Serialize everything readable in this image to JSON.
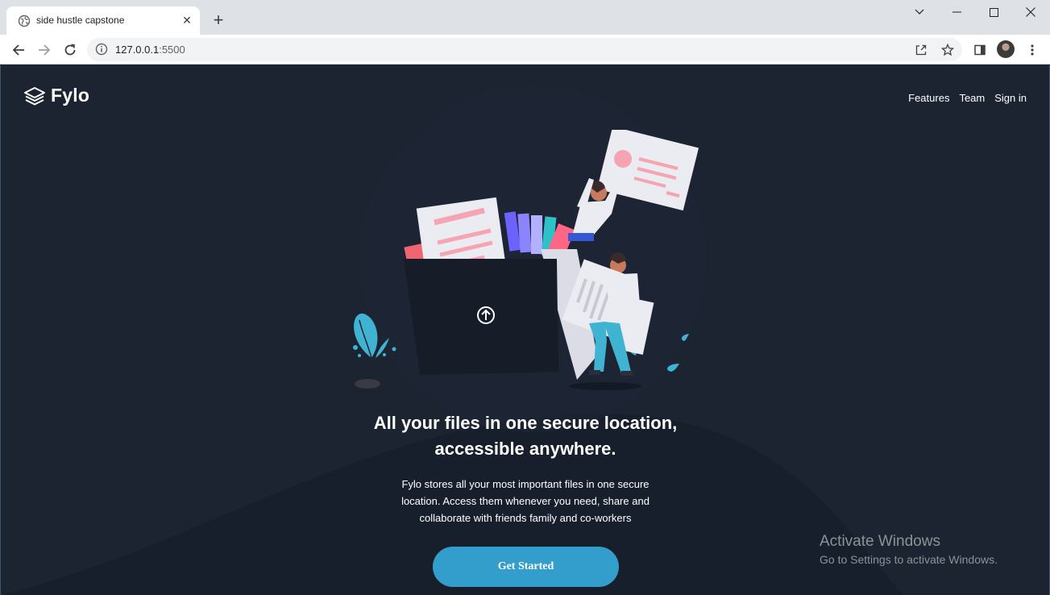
{
  "browser": {
    "tab_title": "side hustle capstone",
    "url_host": "127.0.0.1",
    "url_port": ":5500",
    "icons": {
      "favicon": "globe-icon",
      "tab_close": "close-icon",
      "new_tab": "plus-icon",
      "back": "back-arrow-icon",
      "forward": "forward-arrow-icon",
      "reload": "reload-icon",
      "site_info": "info-icon",
      "share": "share-icon",
      "bookmark": "star-icon",
      "side_panel": "side-panel-icon",
      "profile": "avatar",
      "menu": "kebab-menu-icon"
    },
    "window_controls": [
      "chevron-down-icon",
      "minimize-icon",
      "maximize-icon",
      "close-icon"
    ]
  },
  "page": {
    "brand": "Fylo",
    "nav": [
      "Features",
      "Team",
      "Sign in"
    ],
    "headline_line1": "All your files in one secure location,",
    "headline_line2": "accessible anywhere.",
    "subtext_line1": "Fylo stores all your most important files in one secure",
    "subtext_line2": "location. Access them whenever you need, share and",
    "subtext_line3": "collaborate with friends family and co-workers",
    "cta_label": "Get Started",
    "colors": {
      "background": "#1c2331",
      "cta": "#339ecc",
      "text": "#ffffff"
    }
  },
  "os_watermark": {
    "title": "Activate Windows",
    "subtitle": "Go to Settings to activate Windows."
  }
}
